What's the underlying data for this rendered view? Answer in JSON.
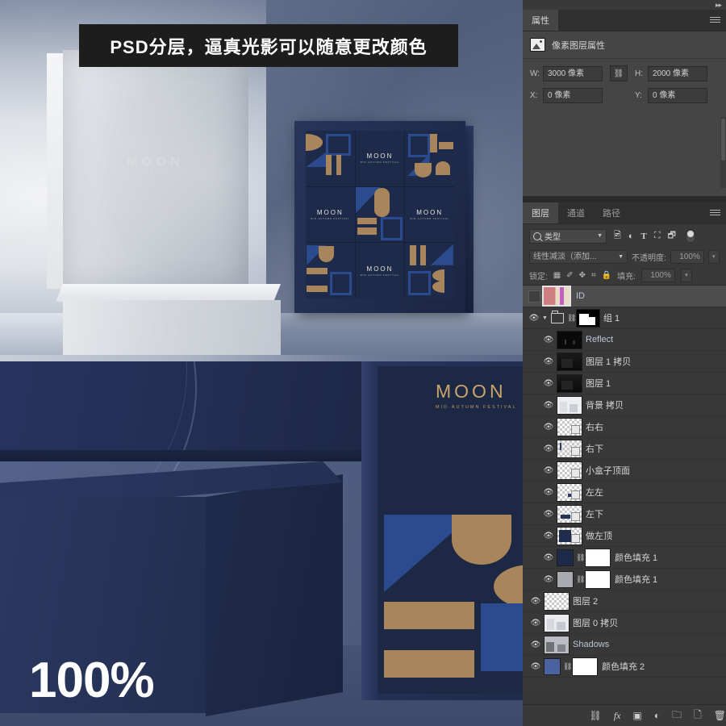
{
  "mockup": {
    "banner_text": "PSD分层，逼真光影可以随意更改颜色",
    "zoom_label": "100%",
    "brand": "MOON",
    "brand_sub": "MID·AUTUMN FESTIVAL",
    "colors": {
      "navy": "#1f2c4c",
      "gold": "#a8855a",
      "accent_blue": "#2c4b8e",
      "paper_grey": "#d3d7dd"
    }
  },
  "properties_panel": {
    "tab_label": "属性",
    "section_title": "像素图层属性",
    "icon": "image-layer-icon",
    "fields": {
      "w_label": "W:",
      "w_value": "3000 像素",
      "h_label": "H:",
      "h_value": "2000 像素",
      "x_label": "X:",
      "x_value": "0 像素",
      "y_label": "Y:",
      "y_value": "0 像素",
      "link_icon": "chain-link-icon"
    }
  },
  "layers_panel": {
    "tabs": [
      {
        "label": "图层",
        "active": true
      },
      {
        "label": "通道",
        "active": false
      },
      {
        "label": "路径",
        "active": false
      }
    ],
    "filter": {
      "kind_label": "类型",
      "search_icon": "search-icon",
      "icons": [
        "pixel-filter-icon",
        "adjustment-filter-icon",
        "type-filter-icon",
        "shape-filter-icon",
        "smart-object-filter-icon"
      ],
      "toggle": "filter-enable-toggle"
    },
    "blend": {
      "mode": "线性减淡（添加...",
      "opacity_label": "不透明度:",
      "opacity_value": "100%"
    },
    "lock": {
      "label": "锁定:",
      "icons": [
        "lock-transparent-icon",
        "lock-image-icon",
        "lock-position-icon",
        "lock-artboard-icon",
        "lock-all-icon"
      ],
      "fill_label": "填充:",
      "fill_value": "100%"
    },
    "rows": [
      {
        "name": "ID",
        "thumb": "id-color",
        "selected": true,
        "eye": false,
        "english": true
      },
      {
        "name": "组 1",
        "thumb": "group-mask",
        "group": true,
        "eye": true,
        "linked": true
      },
      {
        "name": "Reflect",
        "thumb": "dark",
        "eye": true,
        "english": true
      },
      {
        "name": "图层 1 拷贝",
        "thumb": "dark",
        "eye": true
      },
      {
        "name": "图层 1",
        "thumb": "dark",
        "eye": true
      },
      {
        "name": "背景 拷贝",
        "thumb": "light",
        "eye": true
      },
      {
        "name": "右右",
        "thumb": "checker",
        "eye": true
      },
      {
        "name": "右下",
        "thumb": "checker",
        "eye": true
      },
      {
        "name": "小盒子顶面",
        "thumb": "checker",
        "eye": true
      },
      {
        "name": "左左",
        "thumb": "checker",
        "eye": true
      },
      {
        "name": "左下",
        "thumb": "checker",
        "eye": true
      },
      {
        "name": "做左顶",
        "thumb": "checker-navy",
        "eye": true
      },
      {
        "name": "颜色填充 1",
        "thumb": "solid-navy",
        "mask": true,
        "eye": true,
        "linked": true
      },
      {
        "name": "颜色填充 1",
        "thumb": "solid-grey",
        "mask": true,
        "eye": true,
        "linked": true
      },
      {
        "name": "图层 2",
        "thumb": "checker",
        "eye": true
      },
      {
        "name": "图层 0 拷贝",
        "thumb": "light",
        "eye": true
      },
      {
        "name": "Shadows",
        "thumb": "light",
        "eye": true,
        "english": true
      },
      {
        "name": "颜色填充 2",
        "thumb": "solid-blue",
        "mask": true,
        "eye": true,
        "linked": true
      }
    ],
    "footer_icons": [
      "link-layers-icon",
      "fx-icon",
      "add-mask-icon",
      "adjustment-layer-icon",
      "new-group-icon",
      "new-layer-icon",
      "delete-layer-icon"
    ],
    "panel_menu_icon": "panel-menu-icon",
    "collapse_icon": "collapse-panels-icon"
  }
}
